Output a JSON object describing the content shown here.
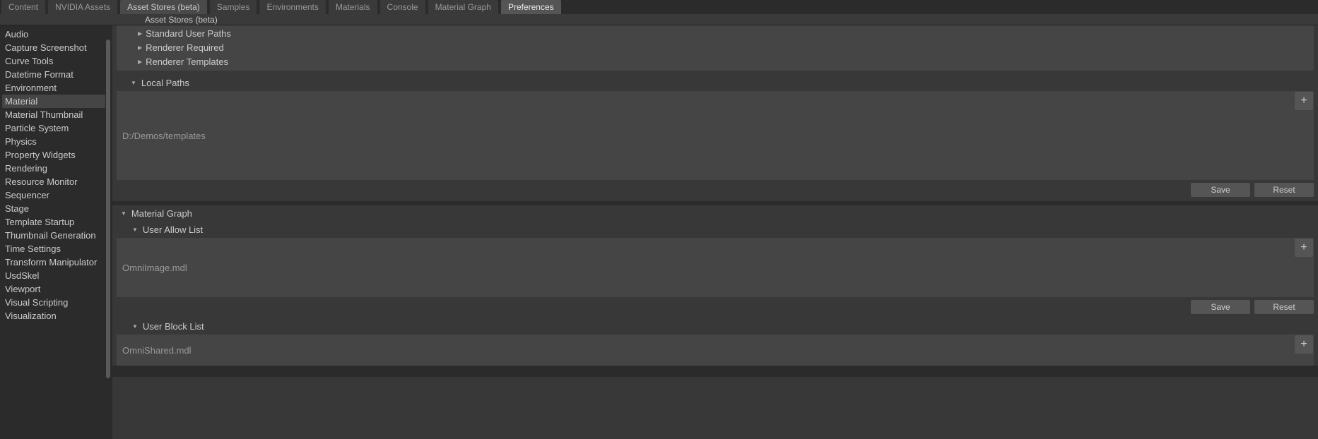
{
  "tabs": [
    {
      "label": "Content"
    },
    {
      "label": "NVIDIA Assets"
    },
    {
      "label": "Asset Stores (beta)"
    },
    {
      "label": "Samples"
    },
    {
      "label": "Environments"
    },
    {
      "label": "Materials"
    },
    {
      "label": "Console"
    },
    {
      "label": "Material Graph"
    },
    {
      "label": "Preferences"
    }
  ],
  "subheader": "Asset Stores (beta)",
  "sidebar": [
    "Audio",
    "Capture Screenshot",
    "Curve Tools",
    "Datetime Format",
    "Environment",
    "Material",
    "Material Thumbnail",
    "Particle System",
    "Physics",
    "Property Widgets",
    "Rendering",
    "Resource Monitor",
    "Sequencer",
    "Stage",
    "Template Startup",
    "Thumbnail Generation",
    "Time Settings",
    "Transform Manipulator",
    "UsdSkel",
    "Viewport",
    "Visual Scripting",
    "Visualization"
  ],
  "sidebar_selected": 5,
  "tree": {
    "row0": "Standard User Paths",
    "row1": "Renderer Required",
    "row2": "Renderer Templates"
  },
  "local_paths": {
    "header": "Local Paths",
    "value": "D:/Demos/templates",
    "save": "Save",
    "reset": "Reset"
  },
  "material_graph": {
    "header": "Material Graph",
    "allow_header": "User Allow List",
    "allow_value": "OmniImage.mdl",
    "save": "Save",
    "reset": "Reset",
    "block_header": "User Block List",
    "block_value": "OmniShared.mdl"
  }
}
